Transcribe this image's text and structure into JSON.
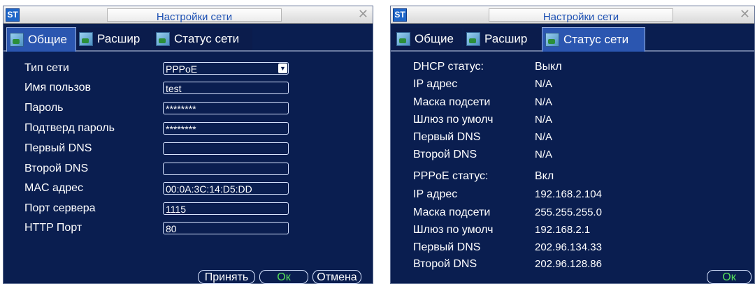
{
  "logo_text": "ST",
  "window1": {
    "title": "Настройки сети",
    "tabs": [
      "Общие",
      "Расшир",
      "Статус сети"
    ],
    "rows": [
      {
        "label": "Тип сети",
        "value": "PPPoE"
      },
      {
        "label": "Имя пользов",
        "value": "test"
      },
      {
        "label": "Пароль",
        "value": "********"
      },
      {
        "label": "Подтверд пароль",
        "value": "********"
      },
      {
        "label": "Первый DNS",
        "value": ""
      },
      {
        "label": "Второй DNS",
        "value": ""
      },
      {
        "label": "MAC адрес",
        "value": "00:0A:3C:14:D5:DD"
      },
      {
        "label": "Порт сервера",
        "value": "1115"
      },
      {
        "label": "HTTP Порт",
        "value": "80"
      }
    ],
    "buttons": {
      "apply": "Принять",
      "ok": "Ок",
      "cancel": "Отмена"
    }
  },
  "window2": {
    "title": "Настройки сети",
    "tabs": [
      "Общие",
      "Расшир",
      "Статус сети"
    ],
    "dhcp": [
      {
        "label": "DHCP статус:",
        "value": "Выкл"
      },
      {
        "label": "IP адрес",
        "value": "N/A"
      },
      {
        "label": "Маска подсети",
        "value": "N/A"
      },
      {
        "label": "Шлюз по умолч",
        "value": "N/A"
      },
      {
        "label": "Первый DNS",
        "value": "N/A"
      },
      {
        "label": "Второй DNS",
        "value": "N/A"
      }
    ],
    "pppoe": [
      {
        "label": "PPPoE статус:",
        "value": "Вкл"
      },
      {
        "label": "IP адрес",
        "value": "192.168.2.104"
      },
      {
        "label": "Маска подсети",
        "value": "255.255.255.0"
      },
      {
        "label": "Шлюз по умолч",
        "value": "192.168.2.1"
      },
      {
        "label": "Первый DNS",
        "value": "202.96.134.33"
      },
      {
        "label": "Второй DNS",
        "value": "202.96.128.86"
      }
    ],
    "buttons": {
      "ok": "Ок"
    }
  },
  "colors": {
    "panel": "#0a1e50",
    "title_text": "#1b4fb3",
    "ok_text": "#55e05a",
    "active_tab": "#2b56b0"
  }
}
